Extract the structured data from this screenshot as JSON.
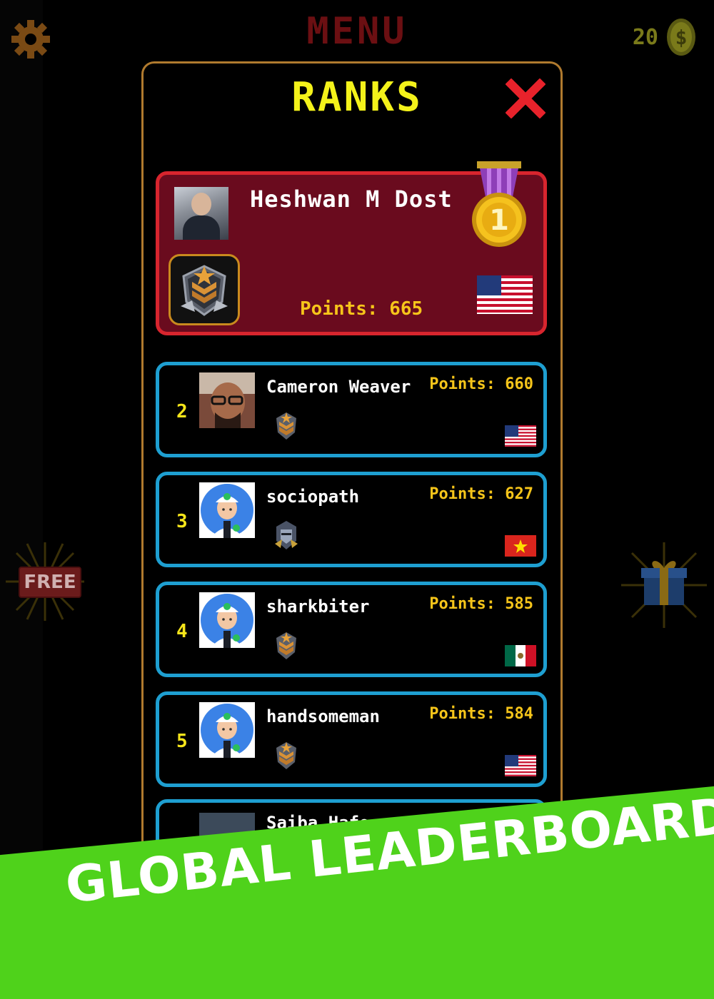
{
  "header": {
    "title": "MENU",
    "coin_count": "20",
    "icons": {
      "settings": "gear-icon",
      "currency": "dollar-coin-icon"
    }
  },
  "promos": {
    "free_label": "FREE",
    "gift_icon": "gift-icon"
  },
  "modal": {
    "title": "RANKS",
    "close_icon": "close-icon"
  },
  "top_player": {
    "rank": 1,
    "name": "Heshwan M Dost",
    "points_text": "Points: 665",
    "country": "United States",
    "medal": "gold-medal-1"
  },
  "players": [
    {
      "rank": "2",
      "name": "Cameron Weaver",
      "points_text": "Points: 660",
      "country": "United States",
      "badge": "bronze-chevron-badge"
    },
    {
      "rank": "3",
      "name": "sociopath",
      "points_text": "Points: 627",
      "country": "Vietnam",
      "badge": "knight-helmet-badge"
    },
    {
      "rank": "4",
      "name": "sharkbiter",
      "points_text": "Points: 585",
      "country": "Mexico",
      "badge": "bronze-chevron-badge"
    },
    {
      "rank": "5",
      "name": "handsomeman",
      "points_text": "Points: 584",
      "country": "United States",
      "badge": "bronze-chevron-badge"
    }
  ],
  "partial_player": {
    "name": "Saiba Hafo"
  },
  "banner": {
    "text": "GLOBAL LEADERBOARDS"
  },
  "colors": {
    "accent_yellow": "#f4f21a",
    "top_card_bg": "#6a0b1e",
    "top_card_border": "#d8252e",
    "row_border": "#1e9fd1",
    "banner_green": "#4fd21b",
    "modal_border": "#b07a2e"
  }
}
